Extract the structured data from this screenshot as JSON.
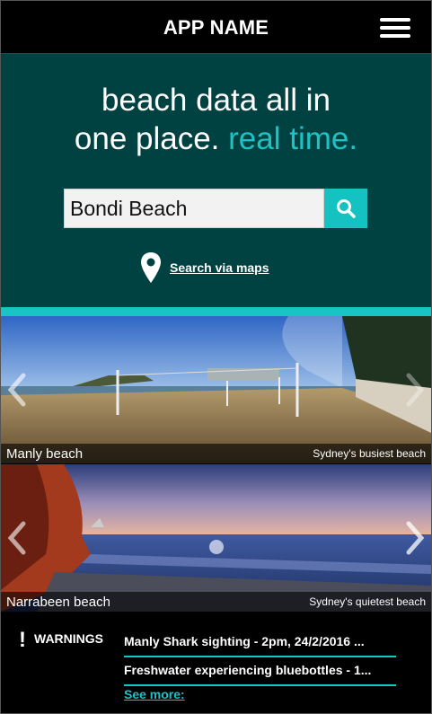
{
  "header": {
    "title": "APP NAME",
    "menu_icon": "hamburger-menu-icon"
  },
  "hero": {
    "headline_line1": "beach data all in",
    "headline_line2_plain": "one place.",
    "headline_line2_accent": "real time.",
    "search_value": "Bondi Beach",
    "search_icon": "search-icon",
    "maps_link_label": "Search via maps",
    "maps_icon": "map-pin-icon"
  },
  "carousel": [
    {
      "name": "Manly beach",
      "subtitle": "Sydney's busiest beach"
    },
    {
      "name": "Narrabeen beach",
      "subtitle": "Sydney's quietest beach"
    }
  ],
  "warnings": {
    "icon": "!",
    "label": "WARNINGS",
    "items": [
      "Manly Shark sighting  - 2pm, 24/2/2016 ...",
      "Freshwater experiencing bluebottles - 1..."
    ],
    "see_more": "See more:"
  },
  "colors": {
    "hero_bg": "#004242",
    "accent": "#19c4c4",
    "topbar": "#000000"
  }
}
